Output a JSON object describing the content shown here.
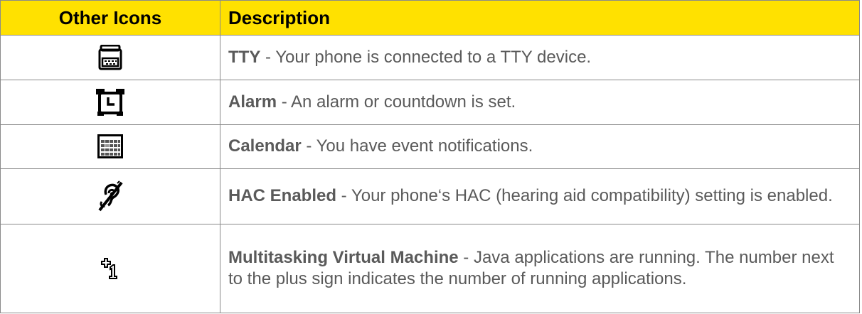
{
  "header": {
    "col1": "Other Icons",
    "col2": "Description"
  },
  "rows": [
    {
      "icon": "tty-icon",
      "term": "TTY",
      "desc": " - Your phone is connected to a TTY device."
    },
    {
      "icon": "alarm-clock-icon",
      "term": "Alarm",
      "desc": " - An alarm or countdown is set."
    },
    {
      "icon": "calendar-icon",
      "term": "Calendar",
      "desc": " - You have event notifications."
    },
    {
      "icon": "hearing-aid-icon",
      "term": "HAC Enabled",
      "desc": " - Your phone‘s HAC (hearing aid compatibility) setting is enabled."
    },
    {
      "icon": "plus-one-icon",
      "term": "Multitasking Virtual Machine",
      "desc": " - Java applications are running. The number next to the plus sign indicates the number of running applications."
    }
  ],
  "colors": {
    "header_bg": "#ffe100",
    "text": "#5a5a5a",
    "border": "#8a8a8a"
  }
}
